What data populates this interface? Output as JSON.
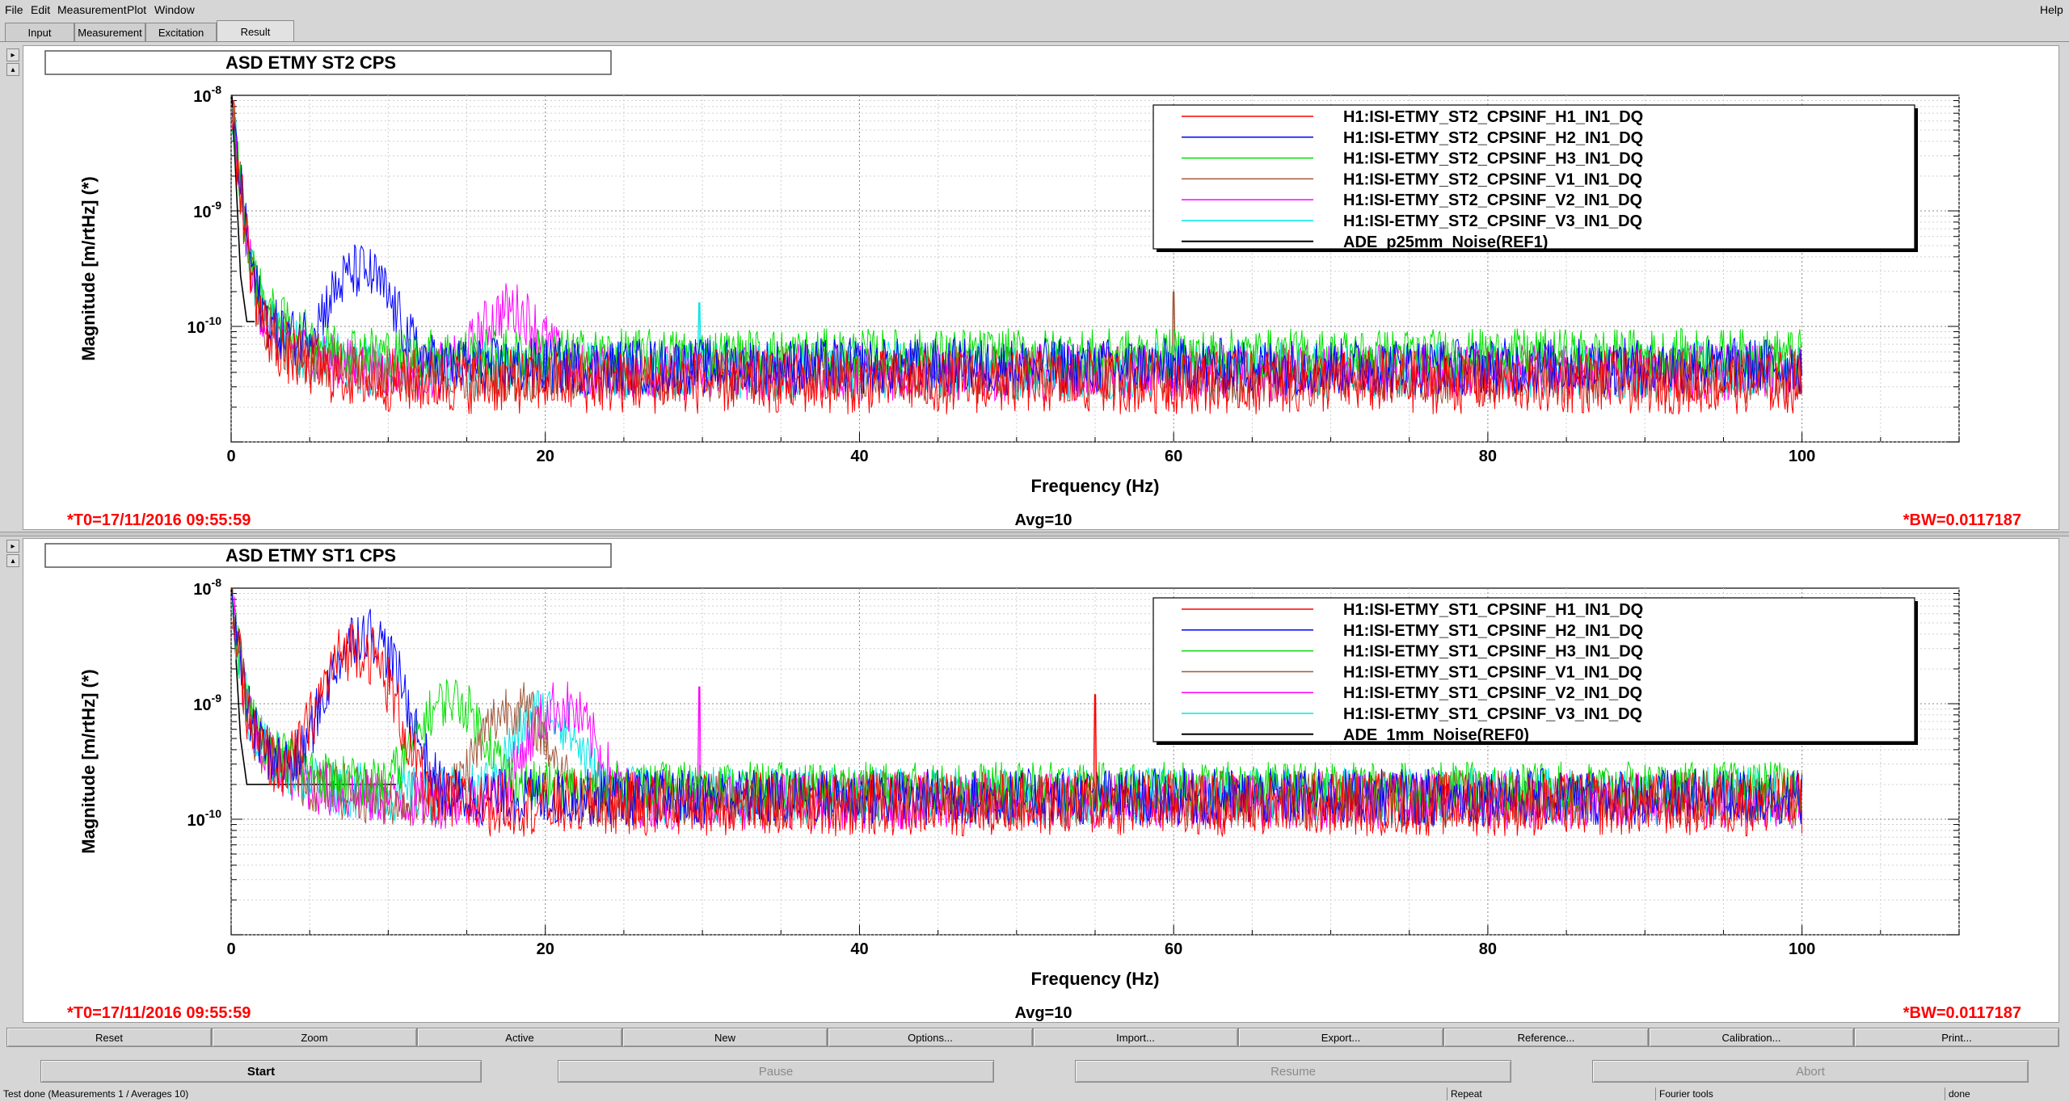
{
  "menu": {
    "items": [
      "File",
      "Edit",
      "Measurement",
      "Plot",
      "Window"
    ],
    "help": "Help"
  },
  "tabs": [
    "Input",
    "Measurement",
    "Excitation",
    "Result"
  ],
  "active_tab": "Result",
  "colors": {
    "h1": "#ff0000",
    "h2": "#0000ff",
    "h3": "#00e000",
    "v1": "#a05a3c",
    "v2": "#ff00ff",
    "v3": "#00e6e6",
    "ref": "#000000",
    "status_text": "#ff0000"
  },
  "chart_data": [
    {
      "type": "line",
      "title": "ASD ETMY ST2 CPS",
      "xlabel": "Frequency (Hz)",
      "ylabel": "Magnitude [m/rtHz] (*)",
      "xlim": [
        0,
        110
      ],
      "ylim": [
        1e-11,
        1e-08
      ],
      "y_scale": "log",
      "x_ticks": [
        0,
        20,
        40,
        60,
        80,
        100
      ],
      "y_tick_labels": [
        "10-8",
        "10-9",
        "10-10"
      ],
      "grid": true,
      "legend_placement": "top-right",
      "series": [
        {
          "name": "H1:ISI-ETMY_ST2_CPSINF_H1_IN1_DQ",
          "color_key": "h1",
          "floor": 3.3e-11,
          "spread": 0.28
        },
        {
          "name": "H1:ISI-ETMY_ST2_CPSINF_H2_IN1_DQ",
          "color_key": "h2",
          "floor": 4.5e-11,
          "spread": 0.25,
          "bump": [
            8.2,
            2.5e-10
          ]
        },
        {
          "name": "H1:ISI-ETMY_ST2_CPSINF_H3_IN1_DQ",
          "color_key": "h3",
          "floor": 5.8e-11,
          "spread": 0.22
        },
        {
          "name": "H1:ISI-ETMY_ST2_CPSINF_V1_IN1_DQ",
          "color_key": "v1",
          "floor": 3.8e-11,
          "spread": 0.25,
          "spike": [
            60,
            2e-10
          ]
        },
        {
          "name": "H1:ISI-ETMY_ST2_CPSINF_V2_IN1_DQ",
          "color_key": "v2",
          "floor": 4e-11,
          "spread": 0.25,
          "bump": [
            17.8,
            1e-10
          ]
        },
        {
          "name": "H1:ISI-ETMY_ST2_CPSINF_V3_IN1_DQ",
          "color_key": "v3",
          "floor": 4.2e-11,
          "spread": 0.25,
          "spike": [
            29.8,
            1.6e-10
          ]
        },
        {
          "name": "ADE_p25mm_Noise(REF1)",
          "color_key": "ref",
          "floor": 1.1e-10,
          "ref": true,
          "x_end": 1.5
        }
      ],
      "t0": "*T0=17/11/2016 09:55:59",
      "avg": "Avg=10",
      "bw": "*BW=0.0117187"
    },
    {
      "type": "line",
      "title": "ASD ETMY ST1 CPS",
      "xlabel": "Frequency (Hz)",
      "ylabel": "Magnitude [m/rtHz] (*)",
      "xlim": [
        0,
        110
      ],
      "ylim": [
        1e-11,
        1e-08
      ],
      "y_scale": "log",
      "x_ticks": [
        0,
        20,
        40,
        60,
        80,
        100
      ],
      "y_tick_labels": [
        "10-8",
        "10-9",
        "10-10"
      ],
      "grid": true,
      "legend_placement": "top-right",
      "series": [
        {
          "name": "H1:ISI-ETMY_ST1_CPSINF_H1_IN1_DQ",
          "color_key": "h1",
          "floor": 1.35e-10,
          "spread": 0.28,
          "bump": [
            8.0,
            3e-09
          ],
          "spike": [
            55,
            1.2e-09
          ]
        },
        {
          "name": "H1:ISI-ETMY_ST1_CPSINF_H2_IN1_DQ",
          "color_key": "h2",
          "floor": 1.55e-10,
          "spread": 0.25,
          "bump": [
            8.5,
            4e-09
          ]
        },
        {
          "name": "H1:ISI-ETMY_ST1_CPSINF_H3_IN1_DQ",
          "color_key": "h3",
          "floor": 1.9e-10,
          "spread": 0.22,
          "bump": [
            14.0,
            9e-10
          ]
        },
        {
          "name": "H1:ISI-ETMY_ST1_CPSINF_V1_IN1_DQ",
          "color_key": "v1",
          "floor": 1.5e-10,
          "spread": 0.25,
          "bump": [
            18.0,
            8e-10
          ]
        },
        {
          "name": "H1:ISI-ETMY_ST1_CPSINF_V2_IN1_DQ",
          "color_key": "v2",
          "floor": 1.45e-10,
          "spread": 0.25,
          "bump": [
            21.0,
            8e-10
          ],
          "spike": [
            29.8,
            1.4e-09
          ]
        },
        {
          "name": "H1:ISI-ETMY_ST1_CPSINF_V3_IN1_DQ",
          "color_key": "v3",
          "floor": 1.6e-10,
          "spread": 0.25,
          "bump": [
            20.0,
            7e-10
          ]
        },
        {
          "name": "ADE_1mm_Noise(REF0)",
          "color_key": "ref",
          "floor": 2e-10,
          "ref": true,
          "x_end": 10.5
        }
      ],
      "t0": "*T0=17/11/2016 09:55:59",
      "avg": "Avg=10",
      "bw": "*BW=0.0117187"
    }
  ],
  "buttons": [
    "Reset",
    "Zoom",
    "Active",
    "New",
    "Options...",
    "Import...",
    "Export...",
    "Reference...",
    "Calibration...",
    "Print..."
  ],
  "control": {
    "start": "Start",
    "pause": "Pause",
    "resume": "Resume",
    "abort": "Abort"
  },
  "status": {
    "message": "Test done (Measurements 1 / Averages 10)",
    "repeat": "Repeat",
    "fourier": "Fourier tools",
    "state": "done"
  }
}
